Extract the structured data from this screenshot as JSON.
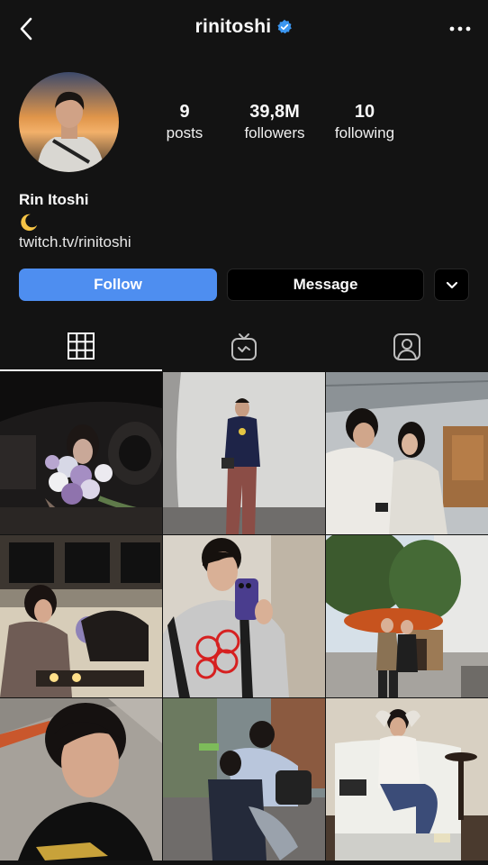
{
  "header": {
    "username": "rinitoshi",
    "verified": true,
    "icons": {
      "back": "chevron-left-icon",
      "more": "more-horizontal-icon",
      "verified": "verified-badge-icon"
    }
  },
  "profile": {
    "display_name": "Rin Itoshi",
    "bio_emoji": "crescent-moon-icon",
    "link": "twitch.tv/rinitoshi",
    "stats": {
      "posts": {
        "value": "9",
        "label": "posts"
      },
      "followers": {
        "value": "39,8M",
        "label": "followers"
      },
      "following": {
        "value": "10",
        "label": "following"
      }
    }
  },
  "actions": {
    "follow_label": "Follow",
    "message_label": "Message",
    "more_icon": "chevron-down-icon"
  },
  "tabs": [
    {
      "name": "grid",
      "icon": "grid-icon",
      "active": true
    },
    {
      "name": "igtv",
      "icon": "igtv-icon",
      "active": false
    },
    {
      "name": "tagged",
      "icon": "tagged-user-icon",
      "active": false
    }
  ],
  "colors": {
    "background": "#131313",
    "accent_blue": "#4e8ef0",
    "verified_blue": "#3b96f0",
    "button_dark": "#000000"
  },
  "posts_count_shown": 9
}
